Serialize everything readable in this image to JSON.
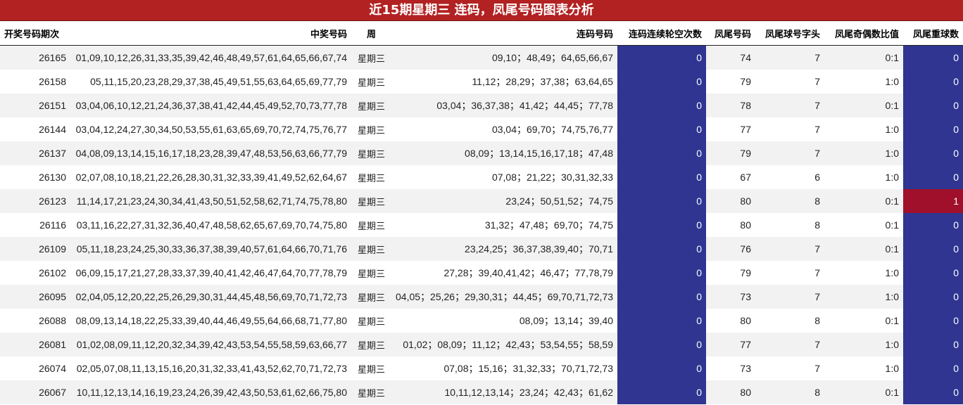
{
  "title": "近15期星期三 连码，凤尾号码图表分析",
  "headers": [
    "开奖号码期次",
    "中奖号码",
    "周",
    "连码号码",
    "连码连续轮空次数",
    "凤尾号码",
    "凤尾球号字头",
    "凤尾奇偶数比值",
    "凤尾重球数"
  ],
  "colors": {
    "title_bg": "#b22222",
    "blue_cell": "#2f3590",
    "red_cell": "#a0102a"
  },
  "rows": [
    {
      "issue": "26165",
      "numbers": "01,09,10,12,26,31,33,35,39,42,46,48,49,57,61,64,65,66,67,74",
      "weekday": "星期三",
      "streaks": "09,10；48,49；64,65,66,67",
      "miss": "0",
      "tail": "74",
      "head": "7",
      "ratio": "0:1",
      "repeat": "0"
    },
    {
      "issue": "26158",
      "numbers": "05,11,15,20,23,28,29,37,38,45,49,51,55,63,64,65,69,77,79",
      "weekday": "星期三",
      "streaks": "11,12；28,29；37,38；63,64,65",
      "miss": "0",
      "tail": "79",
      "head": "7",
      "ratio": "1:0",
      "repeat": "0"
    },
    {
      "issue": "26151",
      "numbers": "03,04,06,10,12,21,24,36,37,38,41,42,44,45,49,52,70,73,77,78",
      "weekday": "星期三",
      "streaks": "03,04；36,37,38；41,42；44,45；77,78",
      "miss": "0",
      "tail": "78",
      "head": "7",
      "ratio": "0:1",
      "repeat": "0"
    },
    {
      "issue": "26144",
      "numbers": "03,04,12,24,27,30,34,50,53,55,61,63,65,69,70,72,74,75,76,77",
      "weekday": "星期三",
      "streaks": "03,04；69,70；74,75,76,77",
      "miss": "0",
      "tail": "77",
      "head": "7",
      "ratio": "1:0",
      "repeat": "0"
    },
    {
      "issue": "26137",
      "numbers": "04,08,09,13,14,15,16,17,18,23,28,39,47,48,53,56,63,66,77,79",
      "weekday": "星期三",
      "streaks": "08,09；13,14,15,16,17,18；47,48",
      "miss": "0",
      "tail": "79",
      "head": "7",
      "ratio": "1:0",
      "repeat": "0"
    },
    {
      "issue": "26130",
      "numbers": "02,07,08,10,18,21,22,26,28,30,31,32,33,39,41,49,52,62,64,67",
      "weekday": "星期三",
      "streaks": "07,08；21,22；30,31,32,33",
      "miss": "0",
      "tail": "67",
      "head": "6",
      "ratio": "1:0",
      "repeat": "0"
    },
    {
      "issue": "26123",
      "numbers": "11,14,17,21,23,24,30,34,41,43,50,51,52,58,62,71,74,75,78,80",
      "weekday": "星期三",
      "streaks": "23,24；50,51,52；74,75",
      "miss": "0",
      "tail": "80",
      "head": "8",
      "ratio": "0:1",
      "repeat": "1"
    },
    {
      "issue": "26116",
      "numbers": "03,11,16,22,27,31,32,36,40,47,48,58,62,65,67,69,70,74,75,80",
      "weekday": "星期三",
      "streaks": "31,32；47,48；69,70；74,75",
      "miss": "0",
      "tail": "80",
      "head": "8",
      "ratio": "0:1",
      "repeat": "0"
    },
    {
      "issue": "26109",
      "numbers": "05,11,18,23,24,25,30,33,36,37,38,39,40,57,61,64,66,70,71,76",
      "weekday": "星期三",
      "streaks": "23,24,25；36,37,38,39,40；70,71",
      "miss": "0",
      "tail": "76",
      "head": "7",
      "ratio": "0:1",
      "repeat": "0"
    },
    {
      "issue": "26102",
      "numbers": "06,09,15,17,21,27,28,33,37,39,40,41,42,46,47,64,70,77,78,79",
      "weekday": "星期三",
      "streaks": "27,28；39,40,41,42；46,47；77,78,79",
      "miss": "0",
      "tail": "79",
      "head": "7",
      "ratio": "1:0",
      "repeat": "0"
    },
    {
      "issue": "26095",
      "numbers": "02,04,05,12,20,22,25,26,29,30,31,44,45,48,56,69,70,71,72,73",
      "weekday": "星期三",
      "streaks": "04,05；25,26；29,30,31；44,45；69,70,71,72,73",
      "miss": "0",
      "tail": "73",
      "head": "7",
      "ratio": "1:0",
      "repeat": "0"
    },
    {
      "issue": "26088",
      "numbers": "08,09,13,14,18,22,25,33,39,40,44,46,49,55,64,66,68,71,77,80",
      "weekday": "星期三",
      "streaks": "08,09；13,14；39,40",
      "miss": "0",
      "tail": "80",
      "head": "8",
      "ratio": "0:1",
      "repeat": "0"
    },
    {
      "issue": "26081",
      "numbers": "01,02,08,09,11,12,20,32,34,39,42,43,53,54,55,58,59,63,66,77",
      "weekday": "星期三",
      "streaks": "01,02；08,09；11,12；42,43；53,54,55；58,59",
      "miss": "0",
      "tail": "77",
      "head": "7",
      "ratio": "1:0",
      "repeat": "0"
    },
    {
      "issue": "26074",
      "numbers": "02,05,07,08,11,13,15,16,20,31,32,33,41,43,52,62,70,71,72,73",
      "weekday": "星期三",
      "streaks": "07,08；15,16；31,32,33；70,71,72,73",
      "miss": "0",
      "tail": "73",
      "head": "7",
      "ratio": "1:0",
      "repeat": "0"
    },
    {
      "issue": "26067",
      "numbers": "10,11,12,13,14,16,19,23,24,26,39,42,43,50,53,61,62,66,75,80",
      "weekday": "星期三",
      "streaks": "10,11,12,13,14；23,24；42,43；61,62",
      "miss": "0",
      "tail": "80",
      "head": "8",
      "ratio": "0:1",
      "repeat": "0"
    }
  ]
}
